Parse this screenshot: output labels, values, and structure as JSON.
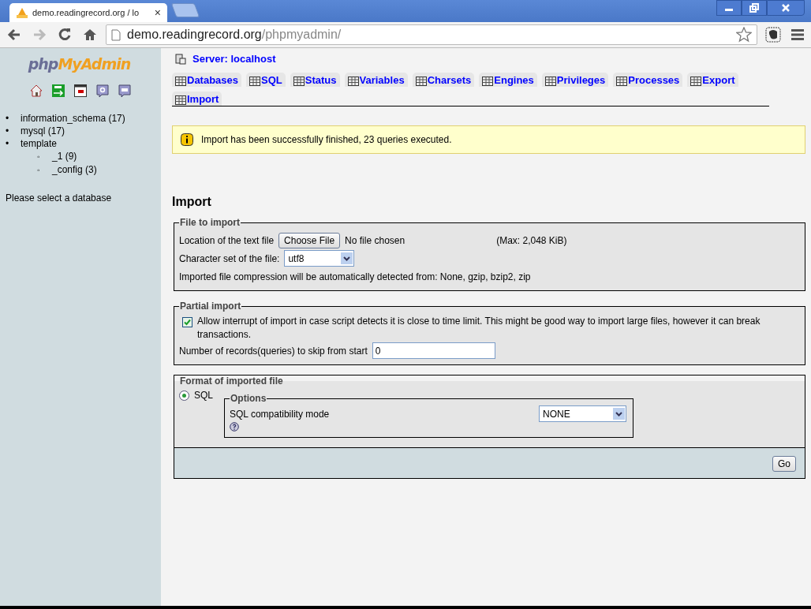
{
  "browser": {
    "tab_title": "demo.readingrecord.org / lo",
    "tab_close": "×",
    "url_host": "demo.readingrecord.org",
    "url_path": "/phpmyadmin/"
  },
  "sidebar": {
    "logo_prefix": "php",
    "logo_name": "MyAdmin",
    "databases": [
      {
        "bullet": "•",
        "label": "information_schema (17)"
      },
      {
        "bullet": "•",
        "label": "mysql (17)"
      },
      {
        "bullet": "•",
        "label": "template",
        "children": [
          {
            "bullet": "◦",
            "label": "_1 (9)"
          },
          {
            "bullet": "◦",
            "label": "_config (3)"
          }
        ]
      }
    ],
    "hint": "Please select a database"
  },
  "server": "Server: localhost",
  "tabs": [
    {
      "label": "Databases",
      "selected": false
    },
    {
      "label": "SQL",
      "selected": false
    },
    {
      "label": "Status",
      "selected": false
    },
    {
      "label": "Variables",
      "selected": false
    },
    {
      "label": "Charsets",
      "selected": false
    },
    {
      "label": "Engines",
      "selected": false
    },
    {
      "label": "Privileges",
      "selected": false
    },
    {
      "label": "Processes",
      "selected": false
    },
    {
      "label": "Export",
      "selected": false
    },
    {
      "label": "Import",
      "selected": false
    }
  ],
  "notice": "Import has been successfully finished, 23 queries executed.",
  "heading": "Import",
  "file_section": {
    "legend": "File to import",
    "location_label": "Location of the text file",
    "choose_button": "Choose File",
    "no_file": "No file chosen",
    "max": "(Max: 2,048 KiB)",
    "charset_label": "Character set of the file:",
    "charset_value": "utf8",
    "compression_note": "Imported file compression will be automatically detected from: None, gzip, bzip2, zip"
  },
  "partial_section": {
    "legend": "Partial import",
    "allow_interrupt": {
      "label": "Allow interrupt of import in case script detects it is close to time limit. This might be good way to import large files, however it can break transactions.",
      "checked": true
    },
    "skip_label": "Number of records(queries) to skip from start",
    "skip_value": "0"
  },
  "format_section": {
    "legend": "Format of imported file",
    "formats": [
      {
        "label": "SQL",
        "selected": true
      }
    ],
    "options_legend": "Options",
    "compat_label": "SQL compatibility mode",
    "compat_value": "NONE"
  },
  "go_button": "Go"
}
